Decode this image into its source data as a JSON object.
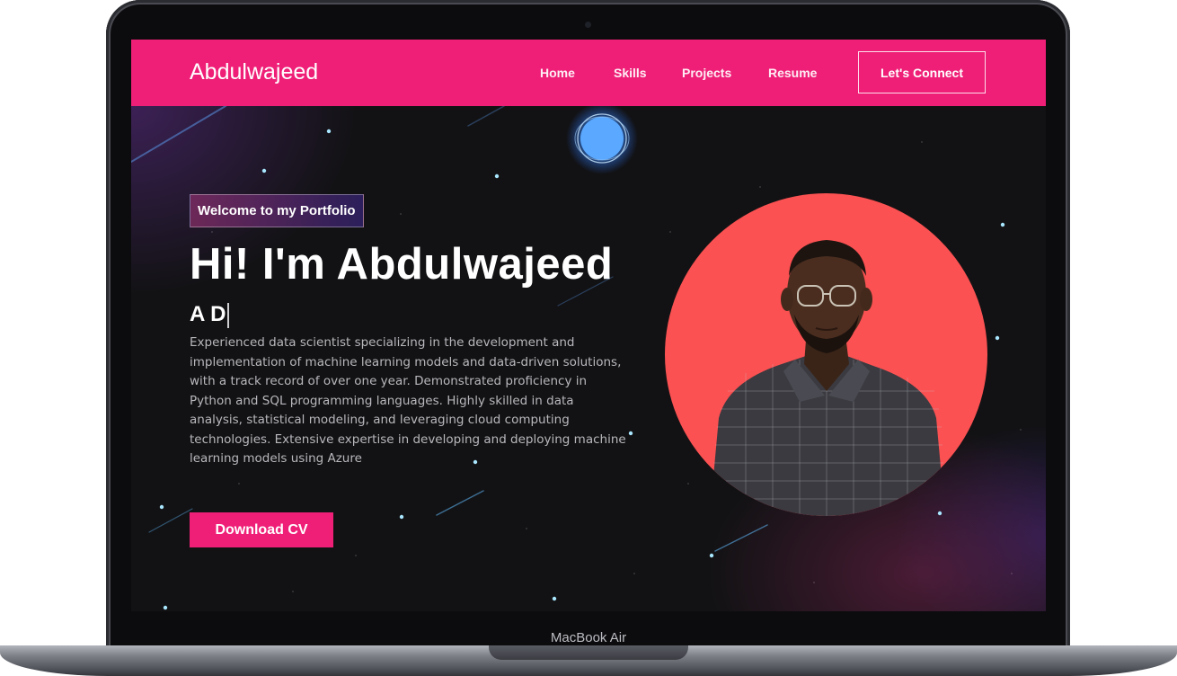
{
  "device": {
    "model_label": "MacBook Air"
  },
  "navbar": {
    "logo": "Abdulwajeed",
    "links": [
      "Home",
      "Skills",
      "Projects",
      "Resume"
    ],
    "cta": "Let's Connect"
  },
  "hero": {
    "tagline": "Welcome to my Portfolio",
    "title": "Hi! I'm Abdulwajeed",
    "typed_text": "A D",
    "description": "Experienced data scientist specializing in the development and implementation of machine learning models and data-driven solutions, with a track record of over one year. Demonstrated proficiency in Python and SQL programming languages. Highly skilled in data analysis, statistical modeling, and leveraging cloud computing technologies. Extensive expertise in developing and deploying machine learning models using Azure",
    "download_button": "Download CV"
  },
  "colors": {
    "accent": "#ef1f77",
    "portrait_circle": "#fb5152",
    "background": "#121214"
  }
}
